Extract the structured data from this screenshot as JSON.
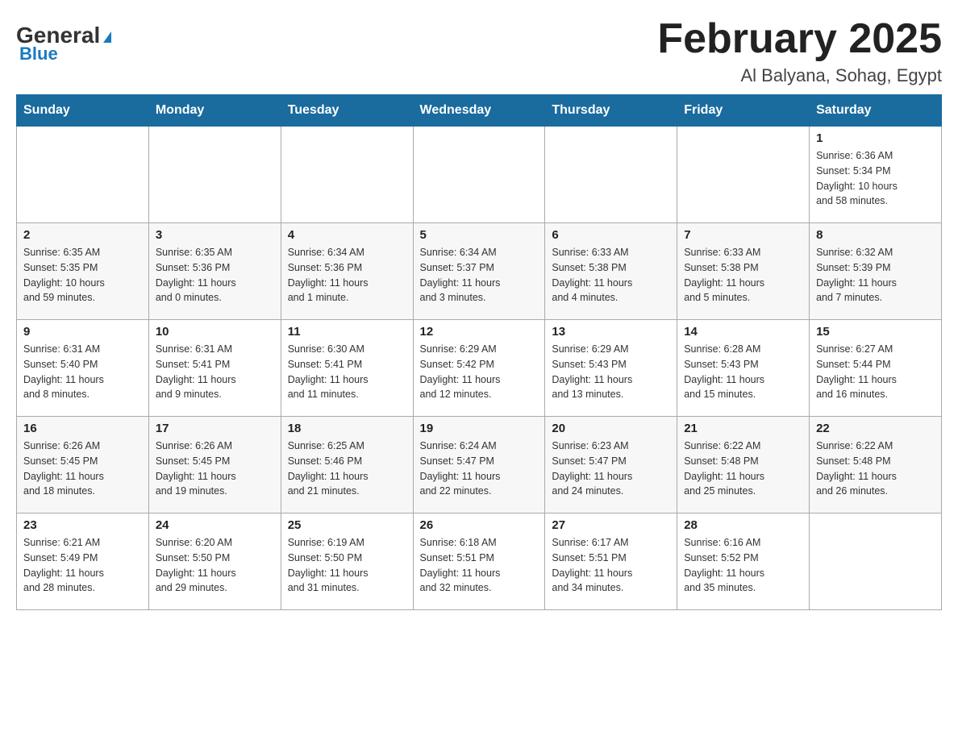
{
  "header": {
    "logo_general": "General",
    "logo_blue": "Blue",
    "month_title": "February 2025",
    "location": "Al Balyana, Sohag, Egypt"
  },
  "days_of_week": [
    "Sunday",
    "Monday",
    "Tuesday",
    "Wednesday",
    "Thursday",
    "Friday",
    "Saturday"
  ],
  "weeks": [
    {
      "days": [
        {
          "number": "",
          "info": ""
        },
        {
          "number": "",
          "info": ""
        },
        {
          "number": "",
          "info": ""
        },
        {
          "number": "",
          "info": ""
        },
        {
          "number": "",
          "info": ""
        },
        {
          "number": "",
          "info": ""
        },
        {
          "number": "1",
          "info": "Sunrise: 6:36 AM\nSunset: 5:34 PM\nDaylight: 10 hours\nand 58 minutes."
        }
      ]
    },
    {
      "days": [
        {
          "number": "2",
          "info": "Sunrise: 6:35 AM\nSunset: 5:35 PM\nDaylight: 10 hours\nand 59 minutes."
        },
        {
          "number": "3",
          "info": "Sunrise: 6:35 AM\nSunset: 5:36 PM\nDaylight: 11 hours\nand 0 minutes."
        },
        {
          "number": "4",
          "info": "Sunrise: 6:34 AM\nSunset: 5:36 PM\nDaylight: 11 hours\nand 1 minute."
        },
        {
          "number": "5",
          "info": "Sunrise: 6:34 AM\nSunset: 5:37 PM\nDaylight: 11 hours\nand 3 minutes."
        },
        {
          "number": "6",
          "info": "Sunrise: 6:33 AM\nSunset: 5:38 PM\nDaylight: 11 hours\nand 4 minutes."
        },
        {
          "number": "7",
          "info": "Sunrise: 6:33 AM\nSunset: 5:38 PM\nDaylight: 11 hours\nand 5 minutes."
        },
        {
          "number": "8",
          "info": "Sunrise: 6:32 AM\nSunset: 5:39 PM\nDaylight: 11 hours\nand 7 minutes."
        }
      ]
    },
    {
      "days": [
        {
          "number": "9",
          "info": "Sunrise: 6:31 AM\nSunset: 5:40 PM\nDaylight: 11 hours\nand 8 minutes."
        },
        {
          "number": "10",
          "info": "Sunrise: 6:31 AM\nSunset: 5:41 PM\nDaylight: 11 hours\nand 9 minutes."
        },
        {
          "number": "11",
          "info": "Sunrise: 6:30 AM\nSunset: 5:41 PM\nDaylight: 11 hours\nand 11 minutes."
        },
        {
          "number": "12",
          "info": "Sunrise: 6:29 AM\nSunset: 5:42 PM\nDaylight: 11 hours\nand 12 minutes."
        },
        {
          "number": "13",
          "info": "Sunrise: 6:29 AM\nSunset: 5:43 PM\nDaylight: 11 hours\nand 13 minutes."
        },
        {
          "number": "14",
          "info": "Sunrise: 6:28 AM\nSunset: 5:43 PM\nDaylight: 11 hours\nand 15 minutes."
        },
        {
          "number": "15",
          "info": "Sunrise: 6:27 AM\nSunset: 5:44 PM\nDaylight: 11 hours\nand 16 minutes."
        }
      ]
    },
    {
      "days": [
        {
          "number": "16",
          "info": "Sunrise: 6:26 AM\nSunset: 5:45 PM\nDaylight: 11 hours\nand 18 minutes."
        },
        {
          "number": "17",
          "info": "Sunrise: 6:26 AM\nSunset: 5:45 PM\nDaylight: 11 hours\nand 19 minutes."
        },
        {
          "number": "18",
          "info": "Sunrise: 6:25 AM\nSunset: 5:46 PM\nDaylight: 11 hours\nand 21 minutes."
        },
        {
          "number": "19",
          "info": "Sunrise: 6:24 AM\nSunset: 5:47 PM\nDaylight: 11 hours\nand 22 minutes."
        },
        {
          "number": "20",
          "info": "Sunrise: 6:23 AM\nSunset: 5:47 PM\nDaylight: 11 hours\nand 24 minutes."
        },
        {
          "number": "21",
          "info": "Sunrise: 6:22 AM\nSunset: 5:48 PM\nDaylight: 11 hours\nand 25 minutes."
        },
        {
          "number": "22",
          "info": "Sunrise: 6:22 AM\nSunset: 5:48 PM\nDaylight: 11 hours\nand 26 minutes."
        }
      ]
    },
    {
      "days": [
        {
          "number": "23",
          "info": "Sunrise: 6:21 AM\nSunset: 5:49 PM\nDaylight: 11 hours\nand 28 minutes."
        },
        {
          "number": "24",
          "info": "Sunrise: 6:20 AM\nSunset: 5:50 PM\nDaylight: 11 hours\nand 29 minutes."
        },
        {
          "number": "25",
          "info": "Sunrise: 6:19 AM\nSunset: 5:50 PM\nDaylight: 11 hours\nand 31 minutes."
        },
        {
          "number": "26",
          "info": "Sunrise: 6:18 AM\nSunset: 5:51 PM\nDaylight: 11 hours\nand 32 minutes."
        },
        {
          "number": "27",
          "info": "Sunrise: 6:17 AM\nSunset: 5:51 PM\nDaylight: 11 hours\nand 34 minutes."
        },
        {
          "number": "28",
          "info": "Sunrise: 6:16 AM\nSunset: 5:52 PM\nDaylight: 11 hours\nand 35 minutes."
        },
        {
          "number": "",
          "info": ""
        }
      ]
    }
  ]
}
